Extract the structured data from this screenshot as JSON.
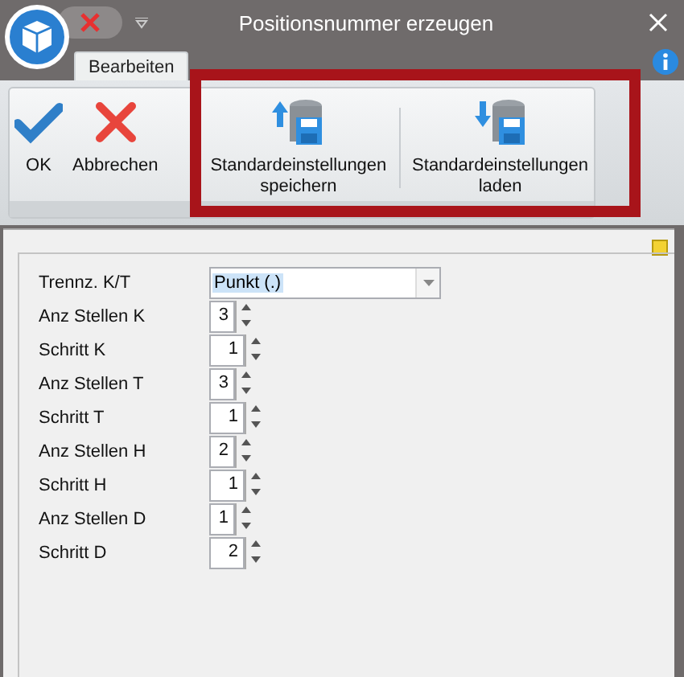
{
  "window": {
    "title": "Positionsnummer erzeugen"
  },
  "ribbon": {
    "tabs": [
      {
        "label": "Bearbeiten",
        "selected": true
      }
    ],
    "buttons": [
      {
        "kind": "ok",
        "label": "OK"
      },
      {
        "kind": "cancel",
        "label": "Abbrechen"
      },
      {
        "kind": "save",
        "label": "Standardeinstellungen speichern"
      },
      {
        "kind": "load",
        "label": "Standardeinstellungen laden"
      }
    ]
  },
  "form": {
    "separator": {
      "label": "Trennz. K/T",
      "value": "Punkt (.)",
      "text_selected": true
    },
    "spinners": [
      {
        "label": "Anz Stellen K",
        "value": "3",
        "kind": "short"
      },
      {
        "label": "Schritt K",
        "value": "1",
        "kind": "long"
      },
      {
        "label": "Anz Stellen T",
        "value": "3",
        "kind": "short"
      },
      {
        "label": "Schritt T",
        "value": "1",
        "kind": "long"
      },
      {
        "label": "Anz Stellen H",
        "value": "2",
        "kind": "short"
      },
      {
        "label": "Schritt H",
        "value": "1",
        "kind": "long"
      },
      {
        "label": "Anz Stellen D",
        "value": "1",
        "kind": "short"
      },
      {
        "label": "Schritt D",
        "value": "2",
        "kind": "long"
      }
    ]
  }
}
